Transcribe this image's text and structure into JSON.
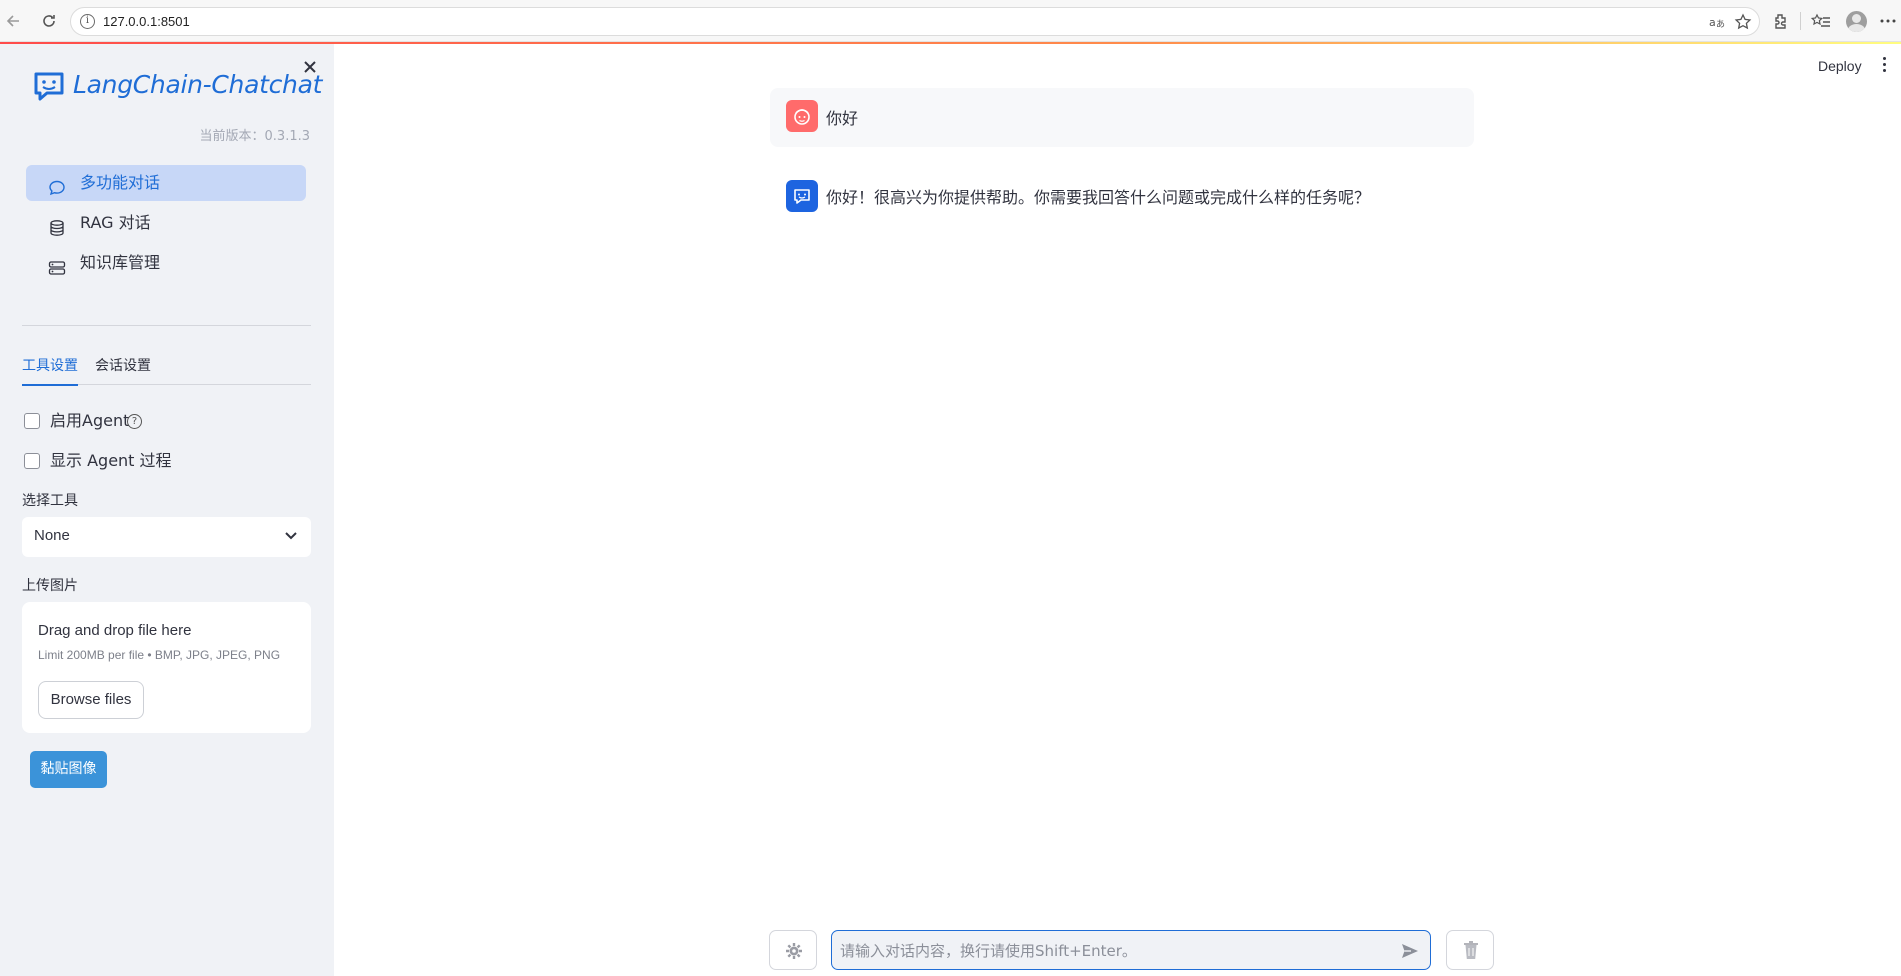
{
  "browser": {
    "url": "127.0.0.1:8501"
  },
  "sidebar": {
    "logo_text": "LangChain-Chatchat",
    "version": "当前版本：0.3.1.3",
    "menu": [
      {
        "label": "多功能对话",
        "icon": "chat-bubble-icon",
        "active": true
      },
      {
        "label": "RAG 对话",
        "icon": "database-icon",
        "active": false
      },
      {
        "label": "知识库管理",
        "icon": "server-icon",
        "active": false
      }
    ],
    "tabs": [
      {
        "label": "工具设置",
        "active": true
      },
      {
        "label": "会话设置",
        "active": false
      }
    ],
    "enable_agent_label": "启用Agent",
    "show_agent_label": "显示 Agent 过程",
    "select_tool_label": "选择工具",
    "select_tool_value": "None",
    "upload_label": "上传图片",
    "uploader": {
      "title": "Drag and drop file here",
      "limit": "Limit 200MB per file • BMP, JPG, JPEG, PNG",
      "browse_label": "Browse files"
    },
    "paste_button": "黏贴图像"
  },
  "header": {
    "deploy": "Deploy"
  },
  "chat": {
    "messages": [
      {
        "role": "user",
        "text": "你好"
      },
      {
        "role": "assistant",
        "text": "你好！很高兴为你提供帮助。你需要我回答什么问题或完成什么样的任务呢？"
      }
    ],
    "input_placeholder": "请输入对话内容，换行请使用Shift+Enter。"
  },
  "colors": {
    "accent": "#1f6dd6",
    "sidebar_bg": "#f0f2f6",
    "user_avatar": "#ff6b6b",
    "bot_avatar": "#1d64e0",
    "paste_button": "#3b93d9"
  }
}
